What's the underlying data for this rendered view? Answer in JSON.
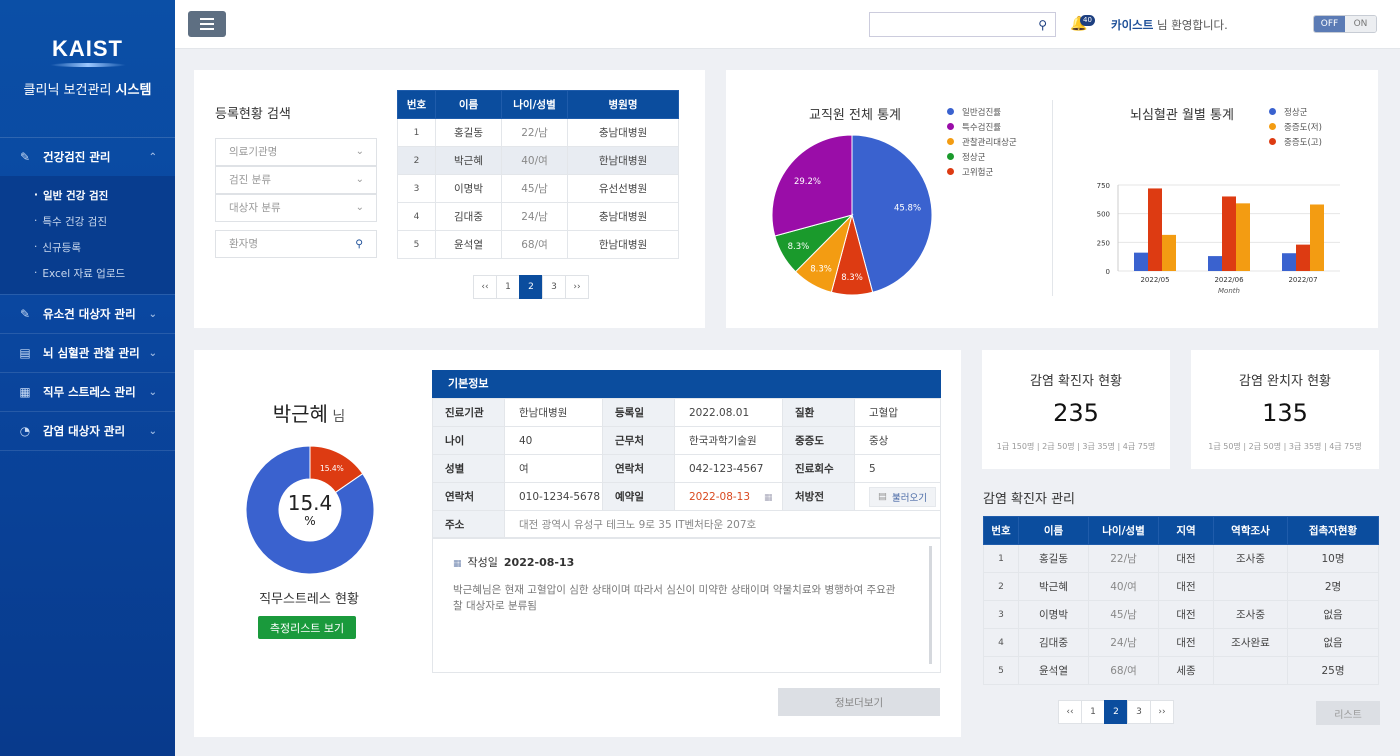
{
  "sidebar": {
    "logo": "KAIST",
    "title_light": "클리닉 보건관리 ",
    "title_bold": "시스템",
    "groups": [
      {
        "label": "건강검진 관리",
        "icon": "document-pen-icon"
      },
      {
        "label": "유소견 대상자 관리",
        "icon": "document-pen-icon"
      },
      {
        "label": "뇌 심혈관 관찰 관리",
        "icon": "clipboard-icon"
      },
      {
        "label": "직무 스트레스 관리",
        "icon": "calendar-icon"
      },
      {
        "label": "감염 대상자 관리",
        "icon": "chart-circle-icon"
      }
    ],
    "sub_items": [
      "일반 건강 검진",
      "특수 건강 검진",
      "신규등록",
      "Excel 자료 업로드"
    ],
    "sub_dot": "·"
  },
  "topbar": {
    "notification_count": "40",
    "welcome_name": "카이스트",
    "welcome_text": " 님 환영합니다.",
    "toggle_off": "OFF",
    "toggle_on": "ON"
  },
  "registration": {
    "title": "등록현황 검색",
    "filters": [
      "의료기관명",
      "검진 분류",
      "대상자 분류"
    ],
    "patient_placeholder": "환자명",
    "columns": [
      "번호",
      "이름",
      "나이/성별",
      "병원명"
    ],
    "rows": [
      [
        "1",
        "홍길동",
        "22/남",
        "충남대병원"
      ],
      [
        "2",
        "박근혜",
        "40/여",
        "한남대병원"
      ],
      [
        "3",
        "이명박",
        "45/남",
        "유선선병원"
      ],
      [
        "4",
        "김대중",
        "24/남",
        "충남대병원"
      ],
      [
        "5",
        "윤석열",
        "68/여",
        "한남대병원"
      ]
    ],
    "pager": [
      "‹‹",
      "1",
      "2",
      "3",
      "››"
    ]
  },
  "staff_stats": {
    "title": "교직원 전체 통계",
    "legend": [
      {
        "label": "일반검진률",
        "color": "#3a62cf"
      },
      {
        "label": "특수검진률",
        "color": "#9a0da8"
      },
      {
        "label": "관찰관리대상군",
        "color": "#f39c12"
      },
      {
        "label": "정상군",
        "color": "#1a9a2c"
      },
      {
        "label": "고위험군",
        "color": "#dd3b12"
      }
    ]
  },
  "cv_stats": {
    "title": "뇌심혈관 월별 통계",
    "legend": [
      {
        "label": "정상군",
        "color": "#3a62cf"
      },
      {
        "label": "중증도(저)",
        "color": "#f39c12"
      },
      {
        "label": "중증도(고)",
        "color": "#dd3b12"
      }
    ]
  },
  "chart_data": [
    {
      "type": "pie",
      "title": "교직원 전체 통계",
      "slices": [
        {
          "label": "일반검진률",
          "value": 45.8,
          "color": "#3a62cf",
          "text": "45.8%"
        },
        {
          "label": "고위험군",
          "value": 8.3,
          "color": "#dd3b12",
          "text": "8.3%"
        },
        {
          "label": "관찰관리대상군",
          "value": 8.3,
          "color": "#f39c12",
          "text": "8.3%"
        },
        {
          "label": "정상군",
          "value": 8.3,
          "color": "#1a9a2c",
          "text": "8.3%"
        },
        {
          "label": "특수검진률",
          "value": 29.2,
          "color": "#9a0da8",
          "text": "29.2%"
        }
      ]
    },
    {
      "type": "bar",
      "title": "뇌심혈관 월별 통계",
      "xlabel": "Month",
      "categories": [
        "2022/05",
        "2022/06",
        "2022/07"
      ],
      "ylim": [
        0,
        750
      ],
      "yticks": [
        0,
        250,
        500,
        750
      ],
      "series": [
        {
          "name": "정상군",
          "color": "#3a62cf",
          "values": [
            160,
            130,
            155
          ]
        },
        {
          "name": "중증도(고)",
          "color": "#dd3b12",
          "values": [
            720,
            650,
            230
          ]
        },
        {
          "name": "중증도(저)",
          "color": "#f39c12",
          "values": [
            315,
            590,
            580
          ]
        }
      ]
    },
    {
      "type": "pie",
      "title": "직무스트레스 현황",
      "slices": [
        {
          "label": "",
          "value": 15.4,
          "color": "#dd3b12",
          "text": "15.4%"
        },
        {
          "label": "",
          "value": 84.6,
          "color": "#3a62cf",
          "text": ""
        }
      ]
    }
  ],
  "patient": {
    "name": "박근혜",
    "suffix": " 님",
    "stress_value": "15.4",
    "stress_unit": "%",
    "stress_title": "직무스트레스 현황",
    "measure_button": "측정리스트 보기",
    "basic_title": "기본정보",
    "info": {
      "clinic_label": "진료기관",
      "clinic": "한남대병원",
      "reg_label": "등록일",
      "reg": "2022.08.01",
      "disease_label": "질환",
      "disease": "고혈압",
      "age_label": "나이",
      "age": "40",
      "work_label": "근무처",
      "work": "한국과학기술원",
      "severity_label": "중증도",
      "severity": "중상",
      "sex_label": "성별",
      "sex": "여",
      "contact2_label": "연락처",
      "contact2": "042-123-4567",
      "visits_label": "진료회수",
      "visits": "5",
      "contact_label": "연락처",
      "contact": "010-1234-5678",
      "appt_label": "예약일",
      "appt": "2022-08-13",
      "rx_label": "처방전",
      "rx_button": "불러오기",
      "addr_label": "주소",
      "addr": "대전 광역시 유성구 테크노 9로 35 IT벤처타운 207호"
    },
    "note_label": "작성일",
    "note_date": "2022-08-13",
    "note_text": "박근혜님은 현재 고혈압이 심한 상태이며 따라서 심신이 미약한 상태이며 약물치료와 병행하여 주요관찰 대상자로 분류됨",
    "more_button": "정보더보기"
  },
  "infection": {
    "confirmed_title": "감염 확진자 현황",
    "confirmed_value": "235",
    "confirmed_sub": "1급 150명 | 2급 50명 | 3급 35명 | 4급 75명",
    "recovered_title": "감염 완치자 현황",
    "recovered_value": "135",
    "recovered_sub": "1급 50명 | 2급 50명 | 3급 35명 | 4급 75명",
    "manage_title": "감염 확진자 관리",
    "columns": [
      "번호",
      "이름",
      "나이/성별",
      "지역",
      "역학조사",
      "접촉자현황"
    ],
    "rows": [
      [
        "1",
        "홍길동",
        "22/남",
        "대전",
        "조사중",
        "10명"
      ],
      [
        "2",
        "박근혜",
        "40/여",
        "대전",
        "",
        "2명"
      ],
      [
        "3",
        "이명박",
        "45/남",
        "대전",
        "조사중",
        "없음"
      ],
      [
        "4",
        "김대중",
        "24/남",
        "대전",
        "조사완료",
        "없음"
      ],
      [
        "5",
        "윤석열",
        "68/여",
        "세종",
        "",
        "25명"
      ]
    ],
    "pager": [
      "‹‹",
      "1",
      "2",
      "3",
      "››"
    ],
    "list_button": "리스트"
  }
}
